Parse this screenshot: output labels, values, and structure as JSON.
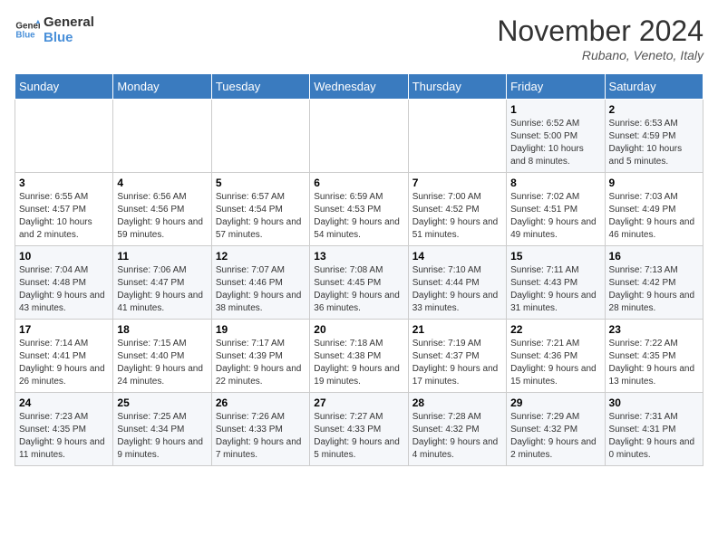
{
  "logo": {
    "line1": "General",
    "line2": "Blue"
  },
  "title": "November 2024",
  "location": "Rubano, Veneto, Italy",
  "weekdays": [
    "Sunday",
    "Monday",
    "Tuesday",
    "Wednesday",
    "Thursday",
    "Friday",
    "Saturday"
  ],
  "weeks": [
    [
      {
        "day": "",
        "info": ""
      },
      {
        "day": "",
        "info": ""
      },
      {
        "day": "",
        "info": ""
      },
      {
        "day": "",
        "info": ""
      },
      {
        "day": "",
        "info": ""
      },
      {
        "day": "1",
        "info": "Sunrise: 6:52 AM\nSunset: 5:00 PM\nDaylight: 10 hours and 8 minutes."
      },
      {
        "day": "2",
        "info": "Sunrise: 6:53 AM\nSunset: 4:59 PM\nDaylight: 10 hours and 5 minutes."
      }
    ],
    [
      {
        "day": "3",
        "info": "Sunrise: 6:55 AM\nSunset: 4:57 PM\nDaylight: 10 hours and 2 minutes."
      },
      {
        "day": "4",
        "info": "Sunrise: 6:56 AM\nSunset: 4:56 PM\nDaylight: 9 hours and 59 minutes."
      },
      {
        "day": "5",
        "info": "Sunrise: 6:57 AM\nSunset: 4:54 PM\nDaylight: 9 hours and 57 minutes."
      },
      {
        "day": "6",
        "info": "Sunrise: 6:59 AM\nSunset: 4:53 PM\nDaylight: 9 hours and 54 minutes."
      },
      {
        "day": "7",
        "info": "Sunrise: 7:00 AM\nSunset: 4:52 PM\nDaylight: 9 hours and 51 minutes."
      },
      {
        "day": "8",
        "info": "Sunrise: 7:02 AM\nSunset: 4:51 PM\nDaylight: 9 hours and 49 minutes."
      },
      {
        "day": "9",
        "info": "Sunrise: 7:03 AM\nSunset: 4:49 PM\nDaylight: 9 hours and 46 minutes."
      }
    ],
    [
      {
        "day": "10",
        "info": "Sunrise: 7:04 AM\nSunset: 4:48 PM\nDaylight: 9 hours and 43 minutes."
      },
      {
        "day": "11",
        "info": "Sunrise: 7:06 AM\nSunset: 4:47 PM\nDaylight: 9 hours and 41 minutes."
      },
      {
        "day": "12",
        "info": "Sunrise: 7:07 AM\nSunset: 4:46 PM\nDaylight: 9 hours and 38 minutes."
      },
      {
        "day": "13",
        "info": "Sunrise: 7:08 AM\nSunset: 4:45 PM\nDaylight: 9 hours and 36 minutes."
      },
      {
        "day": "14",
        "info": "Sunrise: 7:10 AM\nSunset: 4:44 PM\nDaylight: 9 hours and 33 minutes."
      },
      {
        "day": "15",
        "info": "Sunrise: 7:11 AM\nSunset: 4:43 PM\nDaylight: 9 hours and 31 minutes."
      },
      {
        "day": "16",
        "info": "Sunrise: 7:13 AM\nSunset: 4:42 PM\nDaylight: 9 hours and 28 minutes."
      }
    ],
    [
      {
        "day": "17",
        "info": "Sunrise: 7:14 AM\nSunset: 4:41 PM\nDaylight: 9 hours and 26 minutes."
      },
      {
        "day": "18",
        "info": "Sunrise: 7:15 AM\nSunset: 4:40 PM\nDaylight: 9 hours and 24 minutes."
      },
      {
        "day": "19",
        "info": "Sunrise: 7:17 AM\nSunset: 4:39 PM\nDaylight: 9 hours and 22 minutes."
      },
      {
        "day": "20",
        "info": "Sunrise: 7:18 AM\nSunset: 4:38 PM\nDaylight: 9 hours and 19 minutes."
      },
      {
        "day": "21",
        "info": "Sunrise: 7:19 AM\nSunset: 4:37 PM\nDaylight: 9 hours and 17 minutes."
      },
      {
        "day": "22",
        "info": "Sunrise: 7:21 AM\nSunset: 4:36 PM\nDaylight: 9 hours and 15 minutes."
      },
      {
        "day": "23",
        "info": "Sunrise: 7:22 AM\nSunset: 4:35 PM\nDaylight: 9 hours and 13 minutes."
      }
    ],
    [
      {
        "day": "24",
        "info": "Sunrise: 7:23 AM\nSunset: 4:35 PM\nDaylight: 9 hours and 11 minutes."
      },
      {
        "day": "25",
        "info": "Sunrise: 7:25 AM\nSunset: 4:34 PM\nDaylight: 9 hours and 9 minutes."
      },
      {
        "day": "26",
        "info": "Sunrise: 7:26 AM\nSunset: 4:33 PM\nDaylight: 9 hours and 7 minutes."
      },
      {
        "day": "27",
        "info": "Sunrise: 7:27 AM\nSunset: 4:33 PM\nDaylight: 9 hours and 5 minutes."
      },
      {
        "day": "28",
        "info": "Sunrise: 7:28 AM\nSunset: 4:32 PM\nDaylight: 9 hours and 4 minutes."
      },
      {
        "day": "29",
        "info": "Sunrise: 7:29 AM\nSunset: 4:32 PM\nDaylight: 9 hours and 2 minutes."
      },
      {
        "day": "30",
        "info": "Sunrise: 7:31 AM\nSunset: 4:31 PM\nDaylight: 9 hours and 0 minutes."
      }
    ]
  ]
}
